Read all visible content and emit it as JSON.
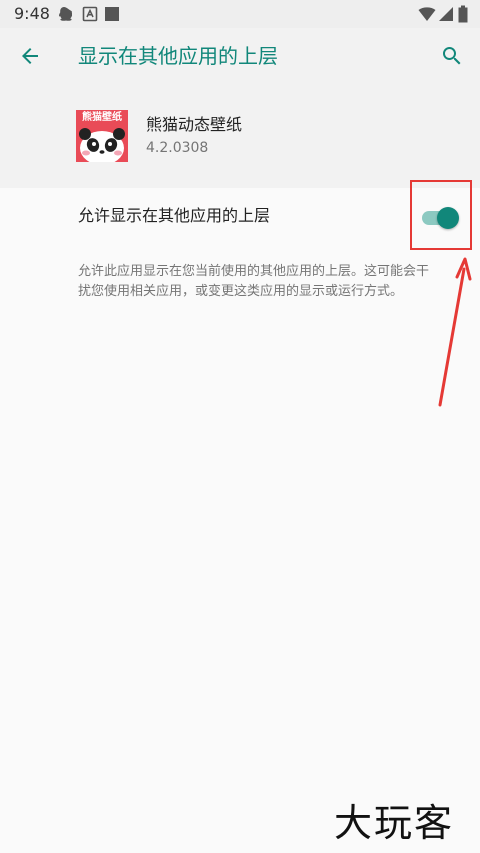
{
  "status_bar": {
    "time": "9:48"
  },
  "app_bar": {
    "title": "显示在其他应用的上层",
    "back_icon": "arrow-left-icon",
    "search_icon": "search-icon"
  },
  "app": {
    "name": "熊猫动态壁纸",
    "version": "4.2.0308",
    "icon_text": "熊猫壁纸"
  },
  "setting": {
    "label": "允许显示在其他应用的上层",
    "enabled": true,
    "description": "允许此应用显示在您当前使用的其他应用的上层。这可能会干扰您使用相关应用，或变更这类应用的显示或运行方式。"
  },
  "colors": {
    "accent": "#11877a",
    "annotation": "#e53935"
  },
  "watermark": "大玩客"
}
